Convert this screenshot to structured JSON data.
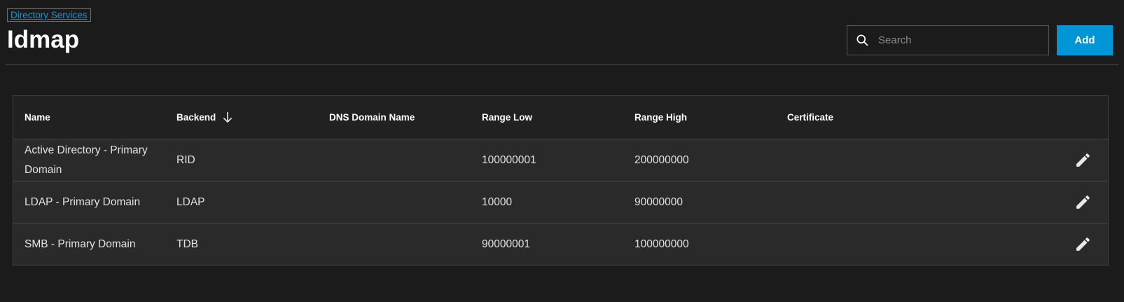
{
  "breadcrumb": {
    "label": "Directory Services"
  },
  "page": {
    "title": "Idmap"
  },
  "toolbar": {
    "search_placeholder": "Search",
    "add_label": "Add"
  },
  "icons": {
    "toolbar_search": "search-icon",
    "backend_sort": "arrow-down-icon",
    "row_edit": "pencil-icon"
  },
  "colors": {
    "accent_blue": "#0095d5",
    "page_background": "#1b1b1b",
    "table_header_background": "#212121",
    "table_row_background": "#2a2a2a"
  },
  "table": {
    "columns": [
      "Name",
      "Backend",
      "DNS Domain Name",
      "Range Low",
      "Range High",
      "Certificate"
    ],
    "sort": {
      "column": "Backend",
      "direction": "descending"
    },
    "rows": [
      {
        "name": "Active Directory - Primary Domain",
        "backend": "RID",
        "dns_domain_name": "",
        "range_low": "100000001",
        "range_high": "200000000",
        "certificate": ""
      },
      {
        "name": "LDAP - Primary Domain",
        "backend": "LDAP",
        "dns_domain_name": "",
        "range_low": "10000",
        "range_high": "90000000",
        "certificate": ""
      },
      {
        "name": "SMB - Primary Domain",
        "backend": "TDB",
        "dns_domain_name": "",
        "range_low": "90000001",
        "range_high": "100000000",
        "certificate": ""
      }
    ]
  }
}
